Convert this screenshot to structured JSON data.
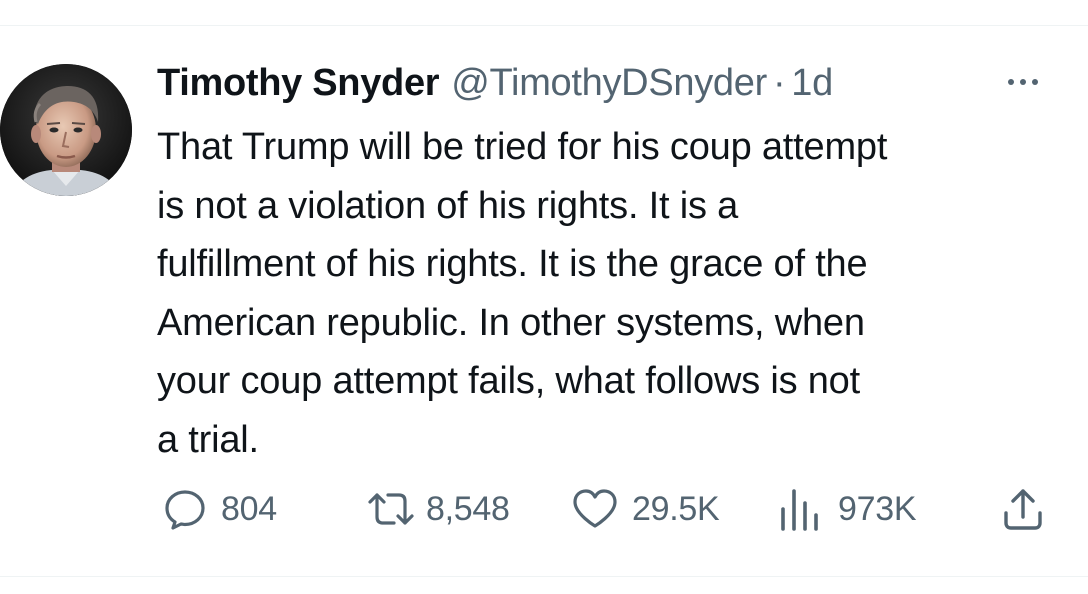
{
  "author": {
    "name": "Timothy Snyder",
    "handle": "@TimothyDSnyder",
    "separator": "·",
    "timestamp": "1d"
  },
  "tweet": {
    "lines": [
      "That Trump will be tried for his coup attempt",
      "is not a violation of his rights. It is a",
      "fulfillment of his rights. It is the grace of the",
      "American republic. In other systems, when",
      "your coup attempt fails, what follows is not",
      "a trial."
    ]
  },
  "actions": {
    "replies": {
      "icon": "reply-icon",
      "count": "804"
    },
    "reposts": {
      "icon": "repost-icon",
      "count": "8,548"
    },
    "likes": {
      "icon": "heart-icon",
      "count": "29.5K"
    },
    "views": {
      "icon": "views-chart-icon",
      "count": "973K"
    },
    "share": {
      "icon": "share-icon"
    }
  },
  "menu": {
    "icon": "more-options-icon"
  },
  "colors": {
    "text": "#0f1419",
    "secondary": "#536471",
    "divider": "#eff3f4"
  }
}
